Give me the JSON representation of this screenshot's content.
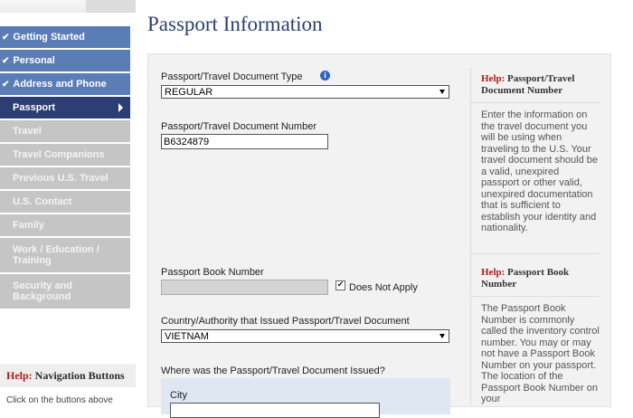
{
  "nav": {
    "items": [
      {
        "label": "Getting Started",
        "state": "done"
      },
      {
        "label": "Personal",
        "state": "done"
      },
      {
        "label": "Address and Phone",
        "state": "done"
      },
      {
        "label": "Passport",
        "state": "current"
      },
      {
        "label": "Travel",
        "state": "todo"
      },
      {
        "label": "Travel Companions",
        "state": "todo"
      },
      {
        "label": "Previous U.S. Travel",
        "state": "todo"
      },
      {
        "label": "U.S. Contact",
        "state": "todo"
      },
      {
        "label": "Family",
        "state": "todo"
      },
      {
        "label": "Work / Education / Training",
        "state": "todo"
      },
      {
        "label": "Security and Background",
        "state": "todo"
      }
    ],
    "help_prefix": "Help:",
    "help_title": "Navigation Buttons",
    "help_text": "Click on the buttons above"
  },
  "page_title": "Passport Information",
  "form": {
    "doc_type_label": "Passport/Travel Document Type",
    "doc_type_value": "REGULAR",
    "doc_number_label": "Passport/Travel Document Number",
    "doc_number_value": "B6324879",
    "book_number_label": "Passport Book Number",
    "book_number_value": "",
    "does_not_apply_label": "Does Not Apply",
    "does_not_apply_checked": true,
    "country_label": "Country/Authority that Issued Passport/Travel Document",
    "country_value": "VIETNAM",
    "issued_where_label": "Where was the Passport/Travel Document Issued?",
    "city_label": "City"
  },
  "help": [
    {
      "prefix": "Help:",
      "title": "Passport/Travel Document Number",
      "body": "Enter the information on the travel document you will be using when traveling to the U.S. Your travel document should be a valid, unexpired passport or other valid, unexpired documentation that is sufficient to establish your identity and nationality."
    },
    {
      "prefix": "Help:",
      "title": "Passport Book Number",
      "body": "The Passport Book Number is commonly called the inventory control number. You may or may not have a Passport Book Number on your passport. The location of the Passport Book Number on your"
    }
  ],
  "colors": {
    "nav_done": "#5b7db6",
    "nav_current": "#2c3e73",
    "nav_todo": "#c5c5c5",
    "title": "#2c3e73",
    "help_red": "#a7201c"
  },
  "icons": {
    "check": "checkmark-icon",
    "info": "info-icon",
    "arrow": "arrow-right-icon",
    "dropdown": "chevron-down-icon"
  }
}
